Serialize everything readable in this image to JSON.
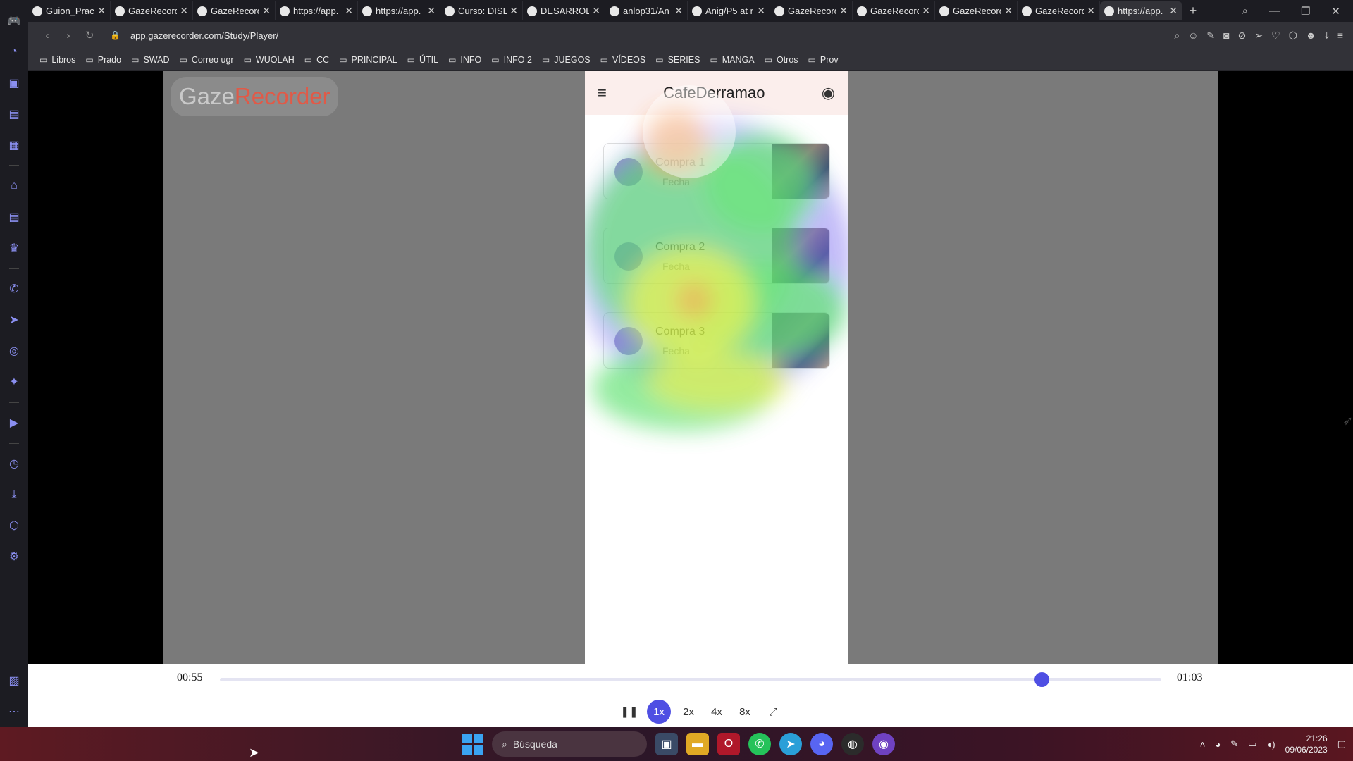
{
  "browser": {
    "tabs": [
      {
        "label": "Guion_Pract",
        "icon": "browser-tab-icon"
      },
      {
        "label": "GazeRecord",
        "icon": "browser-tab-icon"
      },
      {
        "label": "GazeRecord",
        "icon": "browser-tab-icon"
      },
      {
        "label": "https://app.",
        "icon": "browser-tab-icon"
      },
      {
        "label": "https://app.",
        "icon": "browser-tab-icon"
      },
      {
        "label": "Curso: DISE",
        "icon": "leaf-icon"
      },
      {
        "label": "DESARROLL",
        "icon": "leaf-icon"
      },
      {
        "label": "anlop31/An",
        "icon": "github-icon"
      },
      {
        "label": "Anig/P5 at r",
        "icon": "github-icon"
      },
      {
        "label": "GazeRecord",
        "icon": "gmail-icon"
      },
      {
        "label": "GazeRecord",
        "icon": "browser-tab-icon"
      },
      {
        "label": "GazeRecord",
        "icon": "gmail-icon"
      },
      {
        "label": "GazeRecord",
        "icon": "browser-tab-icon"
      },
      {
        "label": "https://app.",
        "icon": "browser-tab-icon"
      }
    ],
    "url": "app.gazerecorder.com/Study/Player/",
    "bookmarks": [
      "Libros",
      "Prado",
      "SWAD",
      "Correo ugr",
      "WUOLAH",
      "CC",
      "PRINCIPAL",
      "ÚTIL",
      "INFO",
      "INFO 2",
      "JUEGOS",
      "VÍDEOS",
      "SERIES",
      "MANGA",
      "Otros",
      "Prov"
    ]
  },
  "player": {
    "logo_gaze": "Gaze",
    "logo_recorder": "Recorder",
    "current_time": "00:55",
    "total_time": "01:03",
    "progress_fraction": 0.873,
    "speeds": [
      "1x",
      "2x",
      "4x",
      "8x"
    ],
    "selected_speed": "1x"
  },
  "app": {
    "title": "CafeDerramao",
    "cards": [
      {
        "title": "Compra 1",
        "date": "Fecha"
      },
      {
        "title": "Compra 2",
        "date": "Fecha"
      },
      {
        "title": "Compra 3",
        "date": "Fecha"
      }
    ]
  },
  "taskbar": {
    "search_placeholder": "Búsqueda",
    "time": "21:26",
    "date": "09/06/2023"
  },
  "colors": {
    "accent": "#4f4fe3",
    "appbar": "#fbeeec",
    "video_bg": "#7a7a7a"
  }
}
